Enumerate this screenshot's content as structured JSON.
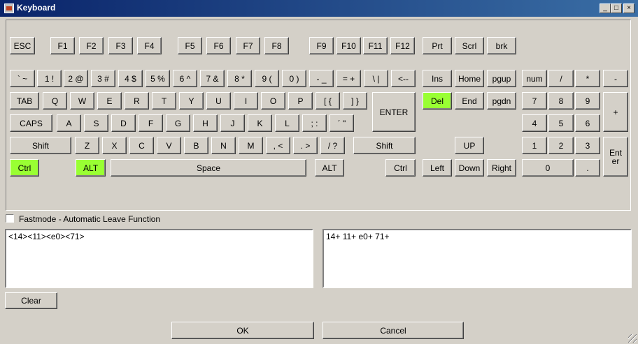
{
  "window": {
    "title": "Keyboard"
  },
  "controls": {
    "minimize": "_",
    "maximize": "□",
    "close": "×"
  },
  "keys": {
    "esc": "ESC",
    "f1": "F1",
    "f2": "F2",
    "f3": "F3",
    "f4": "F4",
    "f5": "F5",
    "f6": "F6",
    "f7": "F7",
    "f8": "F8",
    "f9": "F9",
    "f10": "F10",
    "f11": "F11",
    "f12": "F12",
    "prt": "Prt",
    "scrl": "Scrl",
    "brk": "brk",
    "backtick": "` ~",
    "k1": "1 !",
    "k2": "2 @",
    "k3": "3 #",
    "k4": "4 $",
    "k5": "5 %",
    "k6": "6 ^",
    "k7": "7 &",
    "k8": "8 *",
    "k9": "9 (",
    "k0": "0 )",
    "minus": "- _",
    "equals": "= +",
    "backslash": "\\ |",
    "backspace": "<--",
    "ins": "Ins",
    "home": "Home",
    "pgup": "pgup",
    "num": "num",
    "np_div": "/",
    "np_mul": "*",
    "np_minus": "-",
    "tab": "TAB",
    "q": "Q",
    "w": "W",
    "e": "E",
    "r": "R",
    "t": "T",
    "y": "Y",
    "u": "U",
    "i": "I",
    "o": "O",
    "p": "P",
    "lbracket": "[ {",
    "rbracket": "] }",
    "enter": "ENTER",
    "del": "Del",
    "end": "End",
    "pgdn": "pgdn",
    "np7": "7",
    "np8": "8",
    "np9": "9",
    "np_plus": "+",
    "caps": "CAPS",
    "a": "A",
    "s": "S",
    "d": "D",
    "f": "F",
    "g": "G",
    "h": "H",
    "j": "J",
    "k": "K",
    "l": "L",
    "semicolon": "; :",
    "quote": "´ \"",
    "np4": "4",
    "np5": "5",
    "np6": "6",
    "lshift": "Shift",
    "z": "Z",
    "x": "X",
    "c": "C",
    "v": "V",
    "b": "B",
    "n": "N",
    "m": "M",
    "comma": ", <",
    "period": ". >",
    "slash": "/ ?",
    "rshift": "Shift",
    "up": "UP",
    "np1": "1",
    "np2": "2",
    "np3": "3",
    "np_enter": "Ent\ner",
    "lctrl": "Ctrl",
    "lalt": "ALT",
    "space": "Space",
    "ralt": "ALT",
    "rctrl": "Ctrl",
    "left": "Left",
    "down": "Down",
    "right": "Right",
    "np0": "0",
    "np_dot": "."
  },
  "fastmode": {
    "label": "Fastmode - Automatic Leave Function",
    "checked": false
  },
  "output": {
    "left_text": "<14><11><e0><71>",
    "right_text": "14+ 11+ e0+ 71+"
  },
  "buttons": {
    "clear": "Clear",
    "ok": "OK",
    "cancel": "Cancel"
  }
}
